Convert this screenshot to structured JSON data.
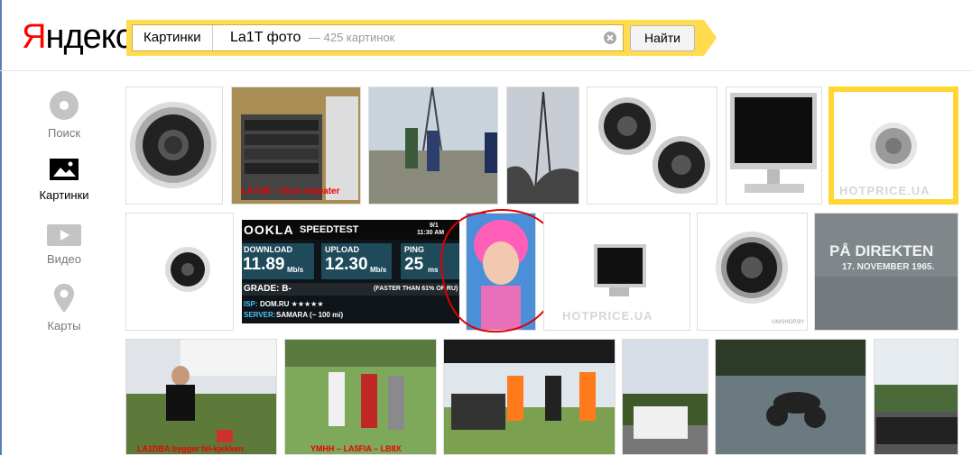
{
  "header": {
    "logo_first": "Я",
    "logo_rest": "ндекс",
    "service": "Картинки",
    "query": "La1T фото",
    "result_count": "— 425 картинок",
    "find_label": "Найти"
  },
  "nav": {
    "items": [
      {
        "label": "Поиск",
        "icon": "search-disc-icon"
      },
      {
        "label": "Картинки",
        "icon": "image-icon"
      },
      {
        "label": "Видео",
        "icon": "video-play-icon"
      },
      {
        "label": "Карты",
        "icon": "map-pin-icon"
      }
    ]
  },
  "results": {
    "row1": [
      {
        "kind": "speaker"
      },
      {
        "kind": "rack",
        "caption": "LA7SR - 70cm repeater"
      },
      {
        "kind": "tower-people",
        "caption": ""
      },
      {
        "kind": "tower",
        "caption": ""
      },
      {
        "kind": "speakers-pair"
      },
      {
        "kind": "monitor"
      },
      {
        "kind": "speaker-watermark",
        "watermark": "HOTPRICE.UA",
        "selected": true
      }
    ],
    "row2": [
      {
        "kind": "speaker-small"
      },
      {
        "kind": "speedtest",
        "brand": "OOKLA",
        "title": "SPEEDTEST",
        "download_label": "DOWNLOAD",
        "download_value": "11.89",
        "download_unit": "Mb/s",
        "upload_label": "UPLOAD",
        "upload_value": "12.30",
        "upload_unit": "Mb/s",
        "ping_label": "PING",
        "ping_value": "25",
        "ping_unit": "ms",
        "grade": "GRADE: B-",
        "faster": "(FASTER THAN 61% OF RU)",
        "isp_label": "ISP:",
        "isp_value": "DOM.RU ★★★★★",
        "server_label": "SERVER:",
        "server_value": "SAMARA (~ 100 mi)",
        "date": "9/1",
        "time": "11:30 AM"
      },
      {
        "kind": "pink-girl"
      },
      {
        "kind": "monitor-watermark",
        "watermark": "HOTPRICE.UA"
      },
      {
        "kind": "speaker-shop",
        "watermark": "UNISHOP.BY"
      },
      {
        "kind": "stone-plaque",
        "line1": "PÅ DIREKTEN",
        "line2": "17. NOVEMBER 1965."
      }
    ],
    "row3": [
      {
        "kind": "photo-man",
        "caption": "LA1DBA bygger fel-kjekken"
      },
      {
        "kind": "photo-group",
        "caption": "YMHH – LA5FIA – LB8X"
      },
      {
        "kind": "photo-tent"
      },
      {
        "kind": "photo-van"
      },
      {
        "kind": "photo-car-antenna"
      },
      {
        "kind": "photo-cars"
      }
    ]
  },
  "colors": {
    "accent_yellow": "#ffdb4d",
    "logo_red": "#ff0000",
    "annotation_red": "#e00000"
  }
}
